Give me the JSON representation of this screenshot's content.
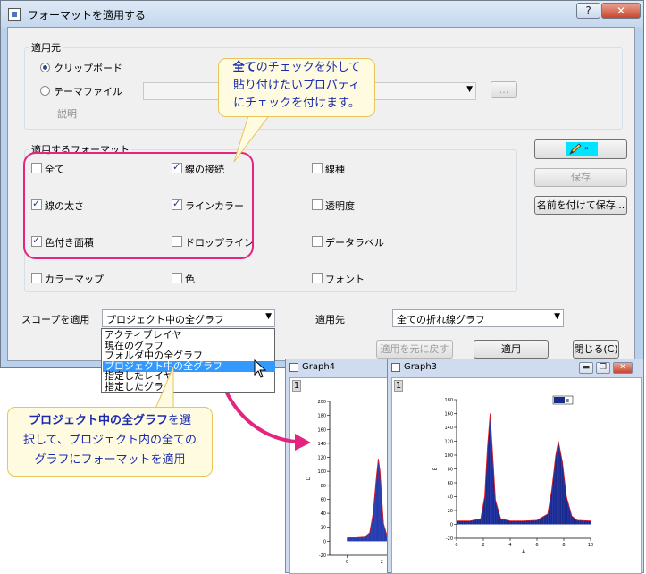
{
  "dialog": {
    "title": "フォーマットを適用する",
    "help_label": "?",
    "close_label": "✕",
    "source": {
      "group_label": "適用元",
      "clipboard_label": "クリップボード",
      "theme_file_label": "テーマファイル",
      "selected": "clipboard",
      "browse_label": "...",
      "description_label": "説明"
    },
    "format": {
      "group_label": "適用するフォーマット",
      "items": [
        {
          "label": "全て",
          "checked": false
        },
        {
          "label": "線の接続",
          "checked": true
        },
        {
          "label": "線種",
          "checked": false
        },
        {
          "label": "線の太さ",
          "checked": true
        },
        {
          "label": "ラインカラー",
          "checked": true
        },
        {
          "label": "透明度",
          "checked": false
        },
        {
          "label": "色付き面積",
          "checked": true
        },
        {
          "label": "ドロップライン",
          "checked": false
        },
        {
          "label": "データラベル",
          "checked": false
        },
        {
          "label": "カラーマップ",
          "checked": false
        },
        {
          "label": "色",
          "checked": false
        },
        {
          "label": "フォント",
          "checked": false
        }
      ]
    },
    "buttons": {
      "save": "保存",
      "save_as": "名前を付けて保存...",
      "revert": "適用を元に戻す",
      "apply": "適用",
      "close": "閉じる(C)"
    },
    "scope": {
      "label": "スコープを適用",
      "value": "プロジェクト中の全グラフ",
      "options": [
        "アクティブレイヤ",
        "現在のグラフ",
        "フォルダ中の全グラフ",
        "プロジェクト中の全グラフ",
        "指定したレイヤ",
        "指定したグラ"
      ],
      "selected_index": 3
    },
    "target": {
      "label": "適用先",
      "value": "全ての折れ線グラフ"
    }
  },
  "callout_top": {
    "line1_bold": "全て",
    "line1_rest": "のチェックを外して",
    "line2": "貼り付けたいプロパティ",
    "line3": "にチェックを付けます。"
  },
  "callout_bottom": {
    "line1_bold": "プロジェクト中の全グラフ",
    "line1_rest": "を選",
    "line2": "択して、プロジェクト内の全ての",
    "line3": "グラフにフォーマットを適用"
  },
  "graph4": {
    "title": "Graph4",
    "page_number": "1",
    "ylabel": "D",
    "yticks": [
      "200",
      "180",
      "160",
      "140",
      "120",
      "100",
      "80",
      "60",
      "40",
      "20",
      "0",
      "-20"
    ],
    "xticks": [
      "0",
      "2"
    ]
  },
  "graph3": {
    "title": "Graph3",
    "page_number": "1",
    "ylabel": "E",
    "xlabel": "A",
    "legend_label": "E",
    "yticks": [
      "180",
      "160",
      "140",
      "120",
      "100",
      "80",
      "60",
      "40",
      "20",
      "0",
      "-20"
    ],
    "xticks": [
      "0",
      "2",
      "4",
      "6",
      "8",
      "10"
    ]
  },
  "chart_data": [
    {
      "type": "area",
      "title": "",
      "xlabel": "",
      "ylabel": "D",
      "ylim": [
        -20,
        200
      ],
      "xlim": [
        -1,
        2.6
      ],
      "series": [
        {
          "x": [
            0,
            0.5,
            1.0,
            1.3,
            1.5,
            1.7,
            1.8,
            1.9,
            2.0,
            2.1,
            2.3,
            2.5
          ],
          "y": [
            5,
            5,
            6,
            12,
            40,
            95,
            118,
            100,
            60,
            25,
            8,
            6
          ]
        }
      ]
    },
    {
      "type": "area",
      "title": "",
      "xlabel": "A",
      "ylabel": "E",
      "ylim": [
        -20,
        180
      ],
      "xlim": [
        0,
        10
      ],
      "series": [
        {
          "name": "E",
          "x": [
            0,
            1,
            1.8,
            2.1,
            2.3,
            2.5,
            2.7,
            2.9,
            3.3,
            4,
            5,
            6,
            6.8,
            7.1,
            7.4,
            7.6,
            7.9,
            8.2,
            8.6,
            9,
            10
          ],
          "y": [
            5,
            5,
            8,
            40,
            110,
            160,
            100,
            35,
            8,
            5,
            5,
            6,
            15,
            50,
            100,
            120,
            90,
            40,
            12,
            6,
            5
          ]
        }
      ]
    }
  ]
}
